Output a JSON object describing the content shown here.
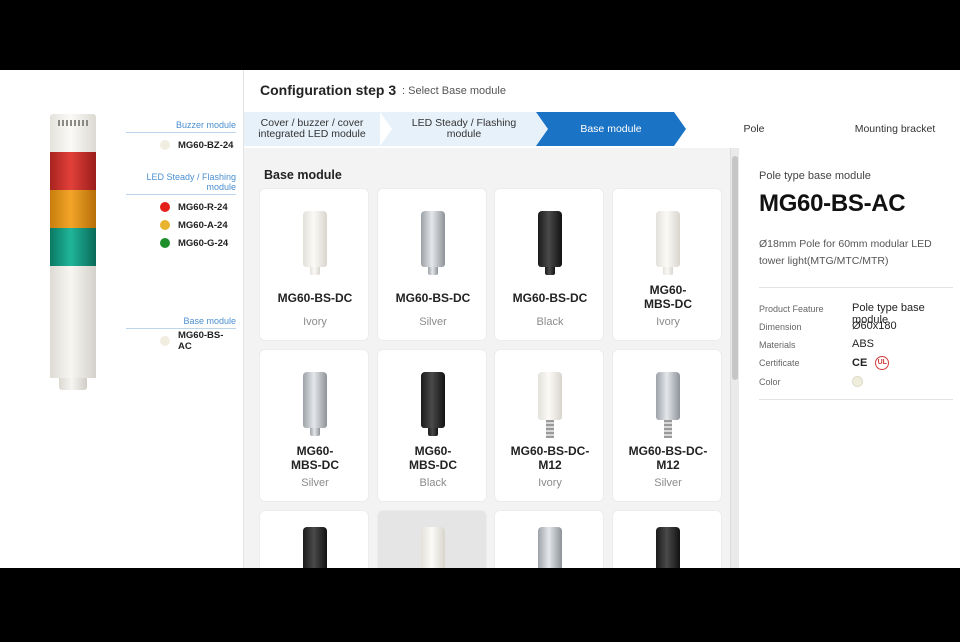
{
  "preview": {
    "groups": [
      {
        "label": "Buzzer module",
        "items": [
          {
            "code": "MG60-BZ-24",
            "color": "#f1ede0"
          }
        ]
      },
      {
        "label": "LED Steady / Flashing module",
        "items": [
          {
            "code": "MG60-R-24",
            "color": "#e3201b"
          },
          {
            "code": "MG60-A-24",
            "color": "#e8b32e"
          },
          {
            "code": "MG60-G-24",
            "color": "#1e8f2b"
          }
        ]
      },
      {
        "label": "Base module",
        "items": [
          {
            "code": "MG60-BS-AC",
            "color": "#f1ede0"
          }
        ]
      }
    ]
  },
  "header": {
    "title": "Configuration step 3",
    "subtitle": ": Select Base module"
  },
  "steps": [
    {
      "label": "Cover / buzzer / cover integrated LED module",
      "state": "done"
    },
    {
      "label": "LED Steady / Flashing module",
      "state": "done"
    },
    {
      "label": "Base module",
      "state": "active"
    },
    {
      "label": "Pole",
      "state": "todo"
    },
    {
      "label": "Mounting bracket",
      "state": "todo"
    }
  ],
  "grid": {
    "title": "Base module",
    "cards": [
      {
        "name": "MG60-BS-DC",
        "color": "Ivory",
        "finish": "ivory"
      },
      {
        "name": "MG60-BS-DC",
        "color": "Silver",
        "finish": "silver"
      },
      {
        "name": "MG60-BS-DC",
        "color": "Black",
        "finish": "black"
      },
      {
        "name": "MG60-MBS-DC",
        "color": "Ivory",
        "finish": "ivory"
      },
      {
        "name": "MG60-MBS-DC",
        "color": "Silver",
        "finish": "silver"
      },
      {
        "name": "MG60-MBS-DC",
        "color": "Black",
        "finish": "black"
      },
      {
        "name": "MG60-BS-DC-M12",
        "color": "Ivory",
        "finish": "ivory"
      },
      {
        "name": "MG60-BS-DC-M12",
        "color": "Silver",
        "finish": "silver"
      }
    ]
  },
  "detail": {
    "type": "Pole type base module",
    "model": "MG60-BS-AC",
    "description": "Ø18mm Pole for 60mm modular LED tower light(MTG/MTC/MTR)",
    "specs": {
      "feature_label": "Product Feature",
      "feature_value": "Pole type base module",
      "dimension_label": "Dimension",
      "dimension_value": "Ø60x180",
      "materials_label": "Materials",
      "materials_value": "ABS",
      "certificate_label": "Certificate",
      "certificate_ce": "CE",
      "certificate_ul": "UL",
      "color_label": "Color",
      "color_value": "#efeedd"
    }
  }
}
